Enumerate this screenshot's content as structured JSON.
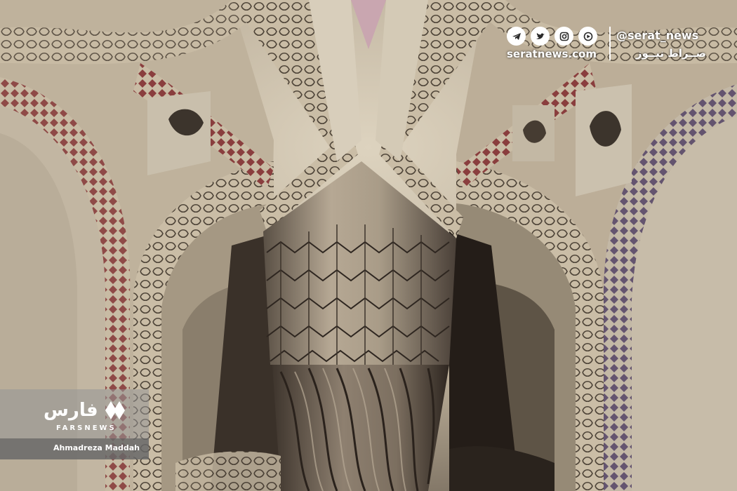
{
  "overlay": {
    "social_icons": [
      "telegram-icon",
      "twitter-icon",
      "instagram-icon",
      "aparat-icon"
    ],
    "site": "seratnews.com",
    "handle": "@serat_news",
    "handle_fa": "صــراط نیــوز"
  },
  "watermark": {
    "logo_fa": "فارس",
    "logo_en": "FARSNEWS",
    "photographer": "Ahmadreza Maddah"
  },
  "colors": {
    "plaster": "#cfc3ad",
    "shadow": "#2e2620",
    "pattern_red": "#8a3e3e",
    "pattern_purple": "#5a4a6a",
    "column": "#9a8e7e"
  }
}
